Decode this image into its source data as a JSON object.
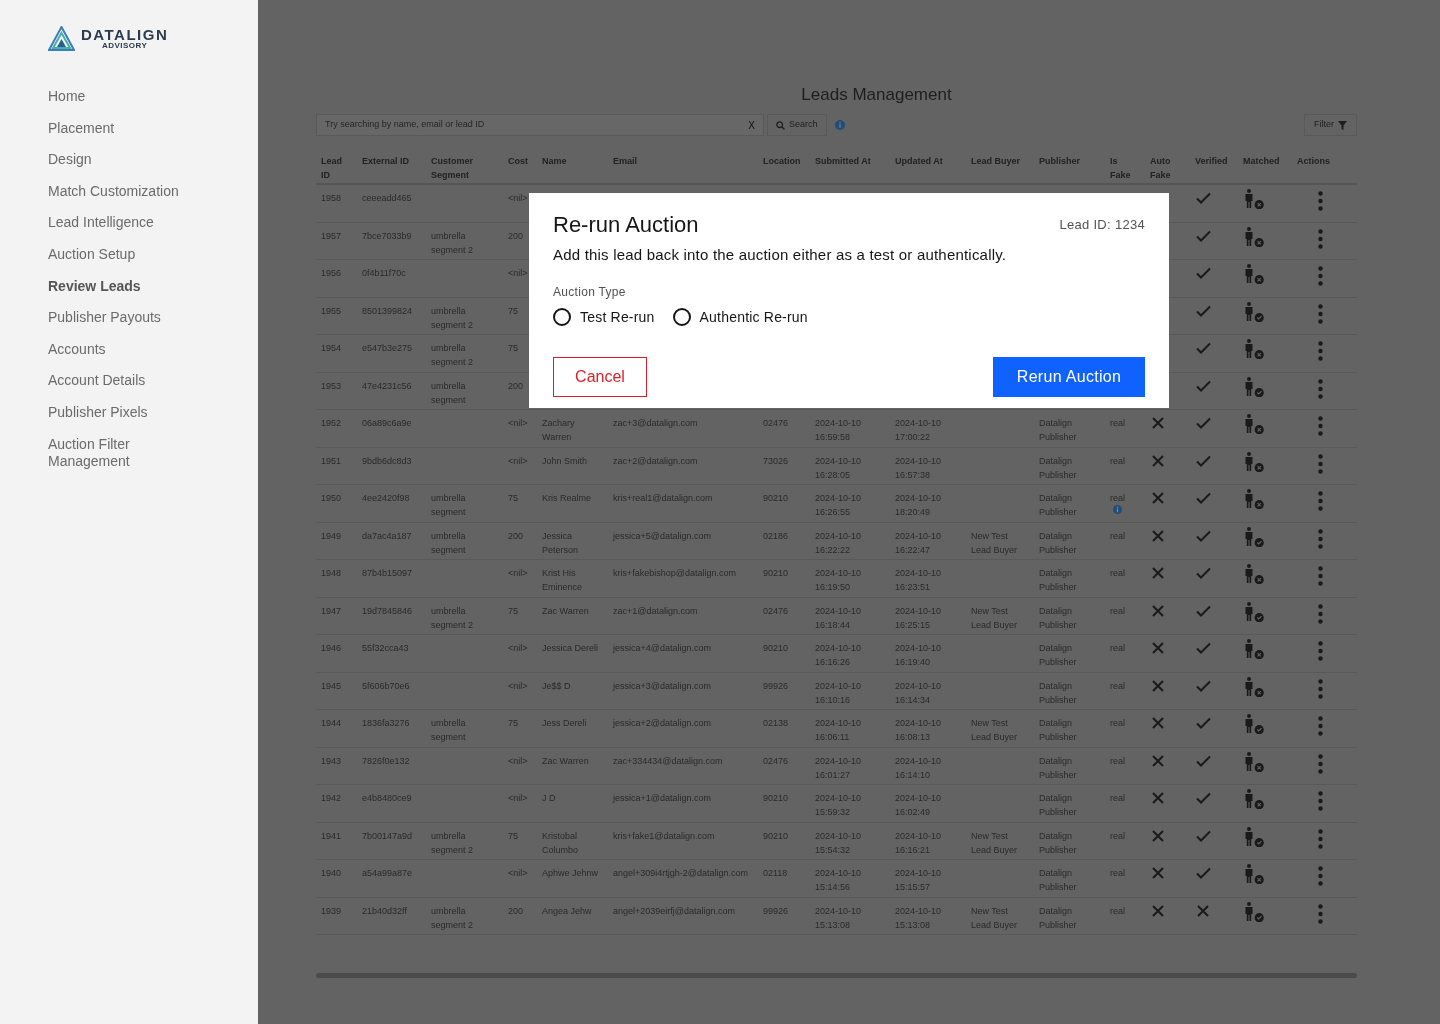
{
  "sidebar": {
    "logo": {
      "name": "DATALIGN",
      "tagline": "ADVISORY"
    },
    "items": [
      {
        "label": "Home",
        "selected": false
      },
      {
        "label": "Placement",
        "selected": false
      },
      {
        "label": "Design",
        "selected": false
      },
      {
        "label": "Match Customization",
        "selected": false
      },
      {
        "label": "Lead Intelligence",
        "selected": false
      },
      {
        "label": "Auction Setup",
        "selected": false
      },
      {
        "label": "Review Leads",
        "selected": true
      },
      {
        "label": "Publisher Payouts",
        "selected": false
      },
      {
        "label": "Accounts",
        "selected": false
      },
      {
        "label": "Account Details",
        "selected": false
      },
      {
        "label": "Publisher Pixels",
        "selected": false
      },
      {
        "label": "Auction Filter Management",
        "selected": false
      }
    ]
  },
  "page": {
    "title": "Leads Management",
    "search": {
      "placeholder": "Try searching by name, email or lead ID",
      "clear": "X",
      "button": "Search"
    },
    "filter": "Filter"
  },
  "table": {
    "columns": [
      "Lead ID",
      "External ID",
      "Customer Segment",
      "Cost",
      "Name",
      "Email",
      "Location",
      "Submitted At",
      "Updated At",
      "Lead Buyer",
      "Publisher",
      "Is Fake",
      "Auto Fake",
      "Verified",
      "Matched",
      "Actions"
    ],
    "rows": [
      {
        "lead_id": "1958",
        "external_id": "ceeeadd465",
        "cost": "<nil>",
        "verified": true,
        "matched": false
      },
      {
        "lead_id": "1957",
        "external_id": "7bce7033b9",
        "segment": "umbrella segment 2",
        "cost": "200",
        "verified": true,
        "matched": false
      },
      {
        "lead_id": "1956",
        "external_id": "0f4b11f70c",
        "cost": "<nil>",
        "verified": true,
        "matched": false
      },
      {
        "lead_id": "1955",
        "external_id": "8501399824",
        "segment": "umbrella segment 2",
        "cost": "75",
        "verified": true,
        "matched": true
      },
      {
        "lead_id": "1954",
        "external_id": "e547b3e275",
        "segment": "umbrella segment 2",
        "cost": "75",
        "verified": true,
        "matched": false
      },
      {
        "lead_id": "1953",
        "external_id": "47e4231c56",
        "segment": "umbrella segment",
        "cost": "200",
        "verified": true,
        "matched": true
      },
      {
        "lead_id": "1952",
        "external_id": "06a89c6a9e",
        "cost": "<nil>",
        "name": "Zachary Warren",
        "email": "zac+3@datalign.com",
        "location": "02476",
        "submitted": "2024-10-10 16:59:58",
        "updated": "2024-10-10 17:00:22",
        "publisher": "Datalign Publisher",
        "is_fake": "real",
        "auto_fake": false,
        "verified": true,
        "matched": false
      },
      {
        "lead_id": "1951",
        "external_id": "9bdb6dc8d3",
        "cost": "<nil>",
        "name": "John Smith",
        "email": "zac+2@datalign.com",
        "location": "73026",
        "submitted": "2024-10-10 16:28:05",
        "updated": "2024-10-10 16:57:38",
        "publisher": "Datalign Publisher",
        "is_fake": "real",
        "auto_fake": false,
        "verified": true,
        "matched": false
      },
      {
        "lead_id": "1950",
        "external_id": "4ee2420f98",
        "segment": "umbrella segment",
        "cost": "75",
        "name": "Kris Realme",
        "email": "kris+real1@datalign.com",
        "location": "90210",
        "submitted": "2024-10-10 16:26:55",
        "updated": "2024-10-10 18:20:49",
        "publisher": "Datalign Publisher",
        "is_fake": "real",
        "fake_info": true,
        "auto_fake": false,
        "verified": true,
        "matched": false
      },
      {
        "lead_id": "1949",
        "external_id": "da7ac4a187",
        "segment": "umbrella segment",
        "cost": "200",
        "name": "Jessica Peterson",
        "email": "jessica+5@datalign.com",
        "location": "02186",
        "submitted": "2024-10-10 16:22:22",
        "updated": "2024-10-10 16:22:47",
        "lead_buyer": "New Test Lead Buyer",
        "publisher": "Datalign Publisher",
        "is_fake": "real",
        "auto_fake": false,
        "verified": true,
        "matched": true
      },
      {
        "lead_id": "1948",
        "external_id": "87b4b15097",
        "cost": "<nil>",
        "name": "Krist His Eminence",
        "email": "kris+fakebishop@datalign.com",
        "location": "90210",
        "submitted": "2024-10-10 16:19:50",
        "updated": "2024-10-10 16:23:51",
        "publisher": "Datalign Publisher",
        "is_fake": "real",
        "auto_fake": false,
        "verified": true,
        "matched": false
      },
      {
        "lead_id": "1947",
        "external_id": "19d7845846",
        "segment": "umbrella segment 2",
        "cost": "75",
        "name": "Zac Warren",
        "email": "zac+1@datalign.com",
        "location": "02476",
        "submitted": "2024-10-10 16:18:44",
        "updated": "2024-10-10 16:25:15",
        "lead_buyer": "New Test Lead Buyer",
        "publisher": "Datalign Publisher",
        "is_fake": "real",
        "auto_fake": false,
        "verified": true,
        "matched": true
      },
      {
        "lead_id": "1946",
        "external_id": "55f32cca43",
        "cost": "<nil>",
        "name": "Jessica Dereli",
        "email": "jessica+4@datalign.com",
        "location": "90210",
        "submitted": "2024-10-10 16:16:26",
        "updated": "2024-10-10 16:19:40",
        "publisher": "Datalign Publisher",
        "is_fake": "real",
        "auto_fake": false,
        "verified": true,
        "matched": false
      },
      {
        "lead_id": "1945",
        "external_id": "5f606b70e6",
        "cost": "<nil>",
        "name": "Je$$ D",
        "email": "jessica+3@datalign.com",
        "location": "99926",
        "submitted": "2024-10-10 16:10:16",
        "updated": "2024-10-10 16:14:34",
        "publisher": "Datalign Publisher",
        "is_fake": "real",
        "auto_fake": false,
        "verified": true,
        "matched": false
      },
      {
        "lead_id": "1944",
        "external_id": "1836fa3276",
        "segment": "umbrella segment",
        "cost": "75",
        "name": "Jess Dereli",
        "email": "jessica+2@datalign.com",
        "location": "02138",
        "submitted": "2024-10-10 16:06:11",
        "updated": "2024-10-10 16:08:13",
        "lead_buyer": "New Test Lead Buyer",
        "publisher": "Datalign Publisher",
        "is_fake": "real",
        "auto_fake": false,
        "verified": true,
        "matched": true
      },
      {
        "lead_id": "1943",
        "external_id": "7826f0e132",
        "cost": "<nil>",
        "name": "Zac Warren",
        "email": "zac+334434@datalign.com",
        "location": "02476",
        "submitted": "2024-10-10 16:01:27",
        "updated": "2024-10-10 16:14:10",
        "publisher": "Datalign Publisher",
        "is_fake": "real",
        "auto_fake": false,
        "verified": true,
        "matched": false
      },
      {
        "lead_id": "1942",
        "external_id": "e4b8480ce9",
        "cost": "<nil>",
        "name": "J D",
        "email": "jessica+1@datalign.com",
        "location": "90210",
        "submitted": "2024-10-10 15:59:32",
        "updated": "2024-10-10 16:02:49",
        "publisher": "Datalign Publisher",
        "is_fake": "real",
        "auto_fake": false,
        "verified": true,
        "matched": false
      },
      {
        "lead_id": "1941",
        "external_id": "7b00147a9d",
        "segment": "umbrella segment 2",
        "cost": "75",
        "name": "Kristobal Columbo",
        "email": "kris+fake1@datalign.com",
        "location": "90210",
        "submitted": "2024-10-10 15:54:32",
        "updated": "2024-10-10 16:16:21",
        "lead_buyer": "New Test Lead Buyer",
        "publisher": "Datalign Publisher",
        "is_fake": "real",
        "auto_fake": false,
        "verified": true,
        "matched": true
      },
      {
        "lead_id": "1940",
        "external_id": "a54a99a87e",
        "cost": "<nil>",
        "name": "Aphwe Jehnw",
        "email": "angel+309i4rtjgh-2@datalign.com",
        "location": "02118",
        "submitted": "2024-10-10 15:14:56",
        "updated": "2024-10-10 15:15:57",
        "publisher": "Datalign Publisher",
        "is_fake": "real",
        "auto_fake": false,
        "verified": true,
        "matched": false
      },
      {
        "lead_id": "1939",
        "external_id": "21b40d32ff",
        "segment": "umbrella segment 2",
        "cost": "200",
        "name": "Angea Jehw",
        "email": "angel+2039eirfj@datalign.com",
        "location": "99926",
        "submitted": "2024-10-10 15:13:08",
        "updated": "2024-10-10 15:13:08",
        "lead_buyer": "New Test Lead Buyer",
        "publisher": "Datalign Publisher",
        "is_fake": "real",
        "auto_fake": false,
        "verified": false,
        "matched": true
      }
    ]
  },
  "modal": {
    "title": "Re-run Auction",
    "lead_id": "Lead ID: 1234",
    "description": "Add this lead back into the auction either as a test or authentically.",
    "field_label": "Auction Type",
    "options": [
      {
        "label": "Test Re-run",
        "selected": false
      },
      {
        "label": "Authentic Re-run",
        "selected": false
      }
    ],
    "cancel": "Cancel",
    "confirm": "Rerun Auction"
  }
}
